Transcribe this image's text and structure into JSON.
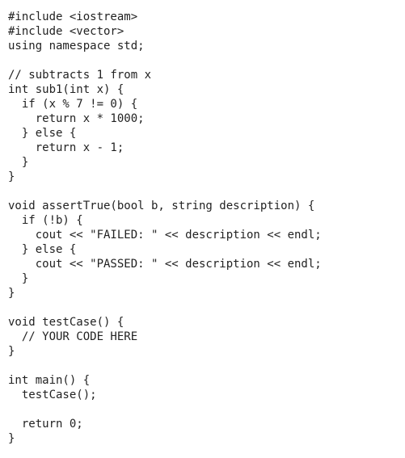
{
  "code": {
    "lines": [
      "#include <iostream>",
      "#include <vector>",
      "using namespace std;",
      "",
      "// subtracts 1 from x",
      "int sub1(int x) {",
      "  if (x % 7 != 0) {",
      "    return x * 1000;",
      "  } else {",
      "    return x - 1;",
      "  }",
      "}",
      "",
      "void assertTrue(bool b, string description) {",
      "  if (!b) {",
      "    cout << \"FAILED: \" << description << endl;",
      "  } else {",
      "    cout << \"PASSED: \" << description << endl;",
      "  }",
      "}",
      "",
      "void testCase() {",
      "  // YOUR CODE HERE",
      "}",
      "",
      "int main() {",
      "  testCase();",
      "",
      "  return 0;",
      "}"
    ]
  }
}
